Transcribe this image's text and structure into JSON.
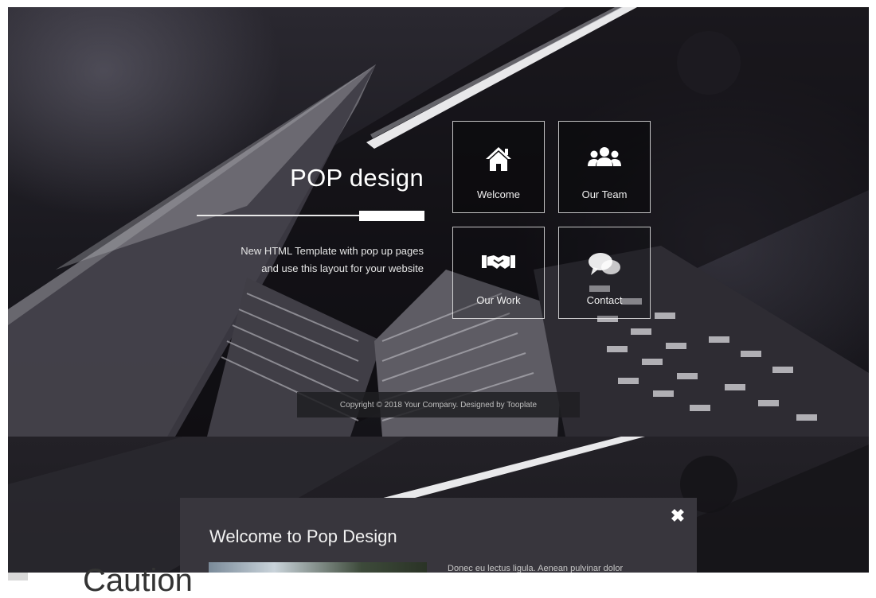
{
  "hero": {
    "brand": "POP design",
    "tagline_line1": "New HTML Template with pop up pages",
    "tagline_line2": "and use this layout for your website",
    "copyright": "Copyright © 2018 Your Company. Designed by Tooplate"
  },
  "menu": [
    {
      "label": "Welcome",
      "icon": "home-icon"
    },
    {
      "label": "Our Team",
      "icon": "users-icon"
    },
    {
      "label": "Our Work",
      "icon": "handshake-icon"
    },
    {
      "label": "Contact",
      "icon": "chat-icon"
    }
  ],
  "modal": {
    "title": "Welcome to Pop Design",
    "close_symbol": "✖",
    "body_text": "Donec eu lectus ligula. Aenean pulvinar dolor"
  },
  "page": {
    "partial_heading": "Caution"
  }
}
